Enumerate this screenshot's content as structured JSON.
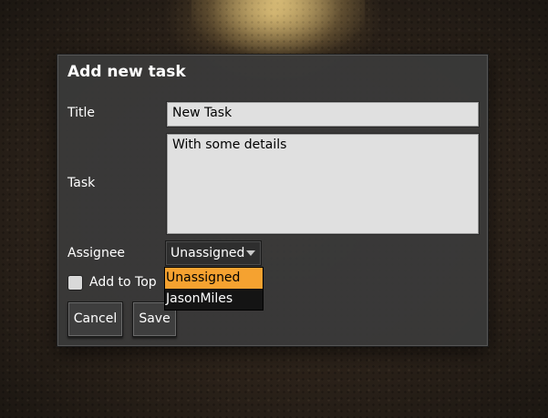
{
  "dialog": {
    "title": "Add new task",
    "fields": {
      "title_label": "Title",
      "title_value": "New Task",
      "task_label": "Task",
      "task_value": "With some details",
      "assignee_label": "Assignee",
      "assignee_selected": "Unassigned",
      "assignee_options": [
        "Unassigned",
        "JasonMiles"
      ],
      "add_to_top_label": "Add to Top",
      "add_to_top_checked": false
    },
    "buttons": {
      "cancel": "Cancel",
      "save": "Save"
    }
  },
  "colors": {
    "dialog_bg": "#3a3a3a",
    "field_bg": "#e0e0e0",
    "highlight": "#f5a230"
  },
  "icons": [
    "caret-down-icon",
    "checkbox-unchecked-icon"
  ]
}
